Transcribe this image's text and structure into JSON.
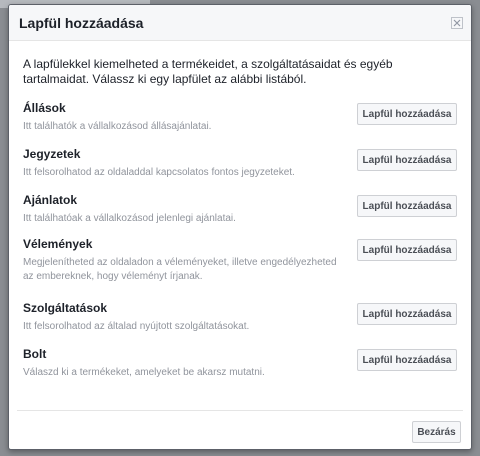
{
  "dialog": {
    "title": "Lapfül hozzáadása",
    "intro": "A lapfülekkel kiemelheted a termékeidet, a szolgáltatásaidat és egyéb tartalmaidat. Válassz ki egy lapfület az alábbi listából.",
    "close_icon": "close-icon",
    "tabs": [
      {
        "name": "Állások",
        "description": "Itt találhatók a vállalkozásod állásajánlatai.",
        "button": "Lapfül hozzáadása"
      },
      {
        "name": "Jegyzetek",
        "description": "Itt felsorolhatod az oldaladdal kapcsolatos fontos jegyzeteket.",
        "button": "Lapfül hozzáadása"
      },
      {
        "name": "Ajánlatok",
        "description": "Itt találhatóak a vállalkozásod jelenlegi ajánlatai.",
        "button": "Lapfül hozzáadása"
      },
      {
        "name": "Vélemények",
        "description": "Megjelenítheted az oldaladon a véleményeket, illetve engedélyezheted az embereknek, hogy véleményt írjanak.",
        "button": "Lapfül hozzáadása"
      },
      {
        "name": "Szolgáltatások",
        "description": "Itt felsorolhatod az általad nyújtott szolgáltatásokat.",
        "button": "Lapfül hozzáadása"
      },
      {
        "name": "Bolt",
        "description": "Válaszd ki a termékeket, amelyeket be akarsz mutatni.",
        "button": "Lapfül hozzáadása"
      }
    ],
    "close_button": "Bezárás"
  }
}
